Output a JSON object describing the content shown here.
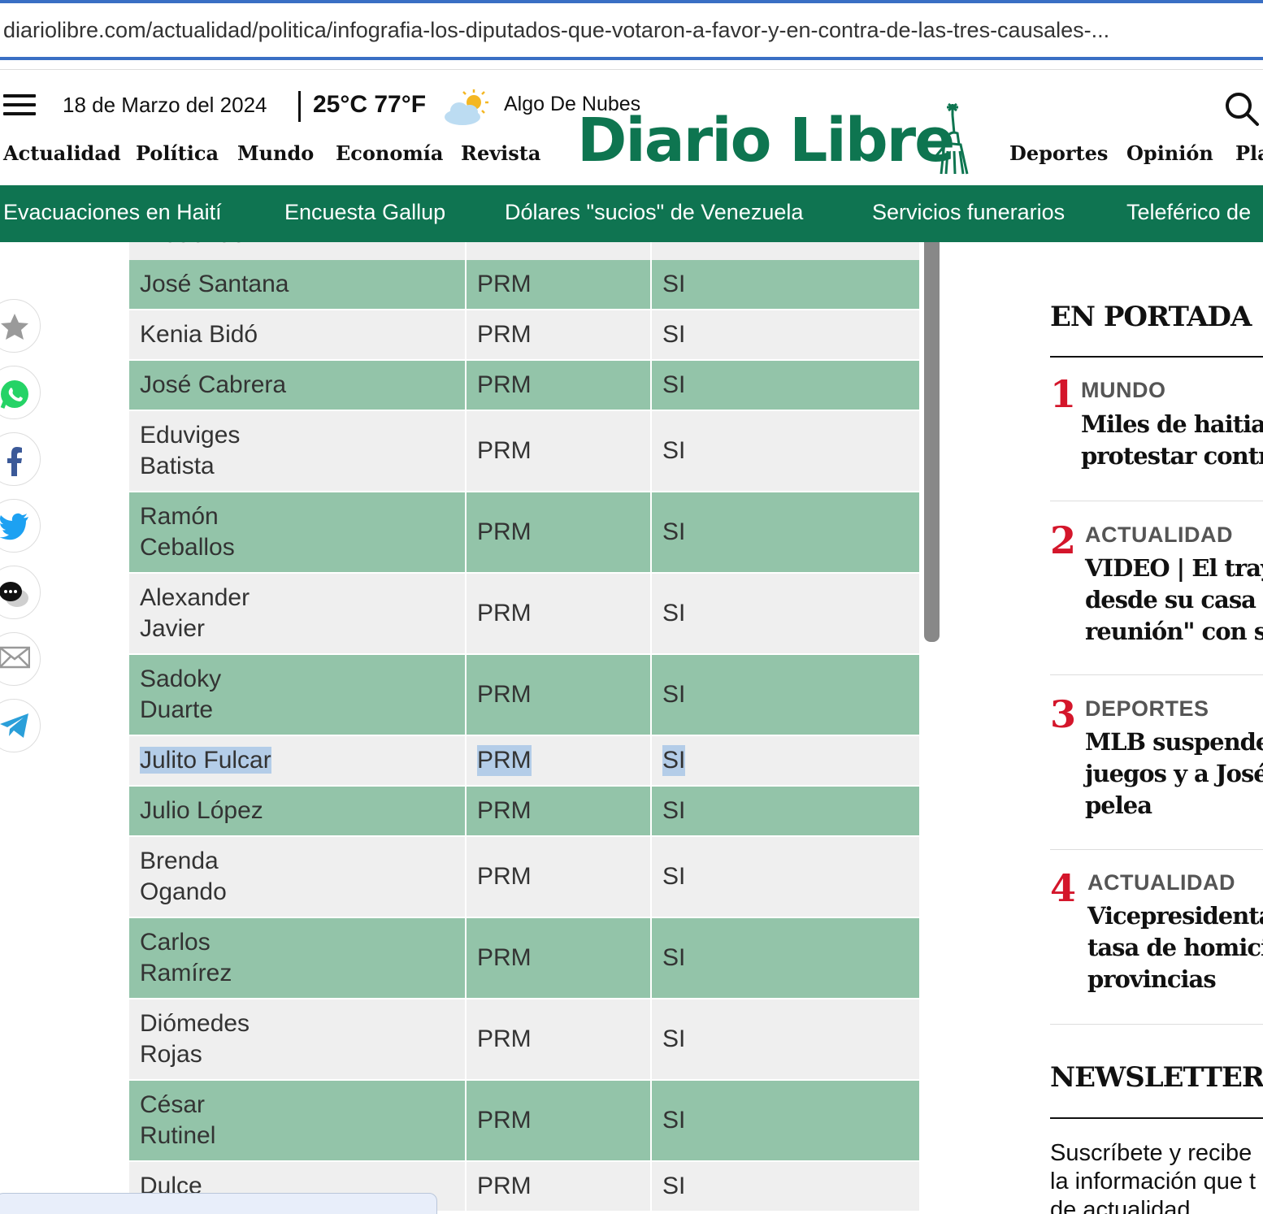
{
  "browser": {
    "url": "diariolibre.com/actualidad/politica/infografia-los-diputados-que-votaron-a-favor-y-en-contra-de-las-tres-causales-..."
  },
  "header": {
    "date": "18 de Marzo del 2024",
    "temperature": "25°C 77°F",
    "weather": "Algo De Nubes",
    "logo": "Diario Libre",
    "nav_left": [
      "Actualidad",
      "Política",
      "Mundo",
      "Economía",
      "Revista"
    ],
    "nav_right": [
      "Deportes",
      "Opinión",
      "Pla"
    ]
  },
  "trending": [
    "Evacuaciones en Haití",
    "Encuesta Gallup",
    "Dólares \"sucios\" de Venezuela",
    "Servicios funerarios",
    "Teleférico de"
  ],
  "share_icons": [
    "star-icon",
    "whatsapp-icon",
    "facebook-icon",
    "twitter-icon",
    "comments-icon",
    "email-icon",
    "telegram-icon"
  ],
  "table": {
    "partial_top": "Arduendo",
    "rows": [
      {
        "name": [
          "José Santana"
        ],
        "party": "PRM",
        "vote": "SI"
      },
      {
        "name": [
          "Kenia Bidó"
        ],
        "party": "PRM",
        "vote": "SI"
      },
      {
        "name": [
          "José Cabrera"
        ],
        "party": "PRM",
        "vote": "SI"
      },
      {
        "name": [
          "Eduviges",
          "Batista"
        ],
        "party": "PRM",
        "vote": "SI"
      },
      {
        "name": [
          "Ramón",
          "Ceballos"
        ],
        "party": "PRM",
        "vote": "SI"
      },
      {
        "name": [
          "Alexander",
          "Javier"
        ],
        "party": "PRM",
        "vote": "SI"
      },
      {
        "name": [
          "Sadoky",
          "Duarte"
        ],
        "party": "PRM",
        "vote": "SI"
      },
      {
        "name": [
          "Julito Fulcar"
        ],
        "party": "PRM",
        "vote": "SI"
      },
      {
        "name": [
          "Julio López"
        ],
        "party": "PRM",
        "vote": "SI"
      },
      {
        "name": [
          "Brenda",
          "Ogando"
        ],
        "party": "PRM",
        "vote": "SI"
      },
      {
        "name": [
          "Carlos",
          "Ramírez"
        ],
        "party": "PRM",
        "vote": "SI"
      },
      {
        "name": [
          "Diómedes",
          "Rojas"
        ],
        "party": "PRM",
        "vote": "SI"
      },
      {
        "name": [
          "César",
          "Rutinel"
        ],
        "party": "PRM",
        "vote": "SI"
      },
      {
        "name": [
          "Dulce"
        ],
        "party": "PRM",
        "vote": "SI"
      }
    ]
  },
  "sidebar": {
    "portada_title": "EN PORTADA",
    "items": [
      {
        "rank": "1",
        "category": "MUNDO",
        "lines": [
          "Miles de haitian",
          "protestar contra"
        ]
      },
      {
        "rank": "2",
        "category": "ACTUALIDAD",
        "lines": [
          "VIDEO | El traye",
          "desde su casa h",
          "reunión\" con su"
        ]
      },
      {
        "rank": "3",
        "category": "DEPORTES",
        "lines": [
          "MLB suspende a",
          "juegos y a José",
          "pelea"
        ]
      },
      {
        "rank": "4",
        "category": "ACTUALIDAD",
        "lines": [
          "Vicepresidenta",
          "tasa de homicid",
          "provincias"
        ]
      }
    ],
    "newsletters_title": "NEWSLETTERS",
    "newsletters_lines": [
      "Suscríbete y recibe",
      "la información que t",
      "de actualidad"
    ]
  },
  "colors": {
    "brand_green": "#0f7451",
    "row_green": "#93c4a9",
    "row_gray": "#efefef",
    "rank_red": "#d4162b"
  }
}
